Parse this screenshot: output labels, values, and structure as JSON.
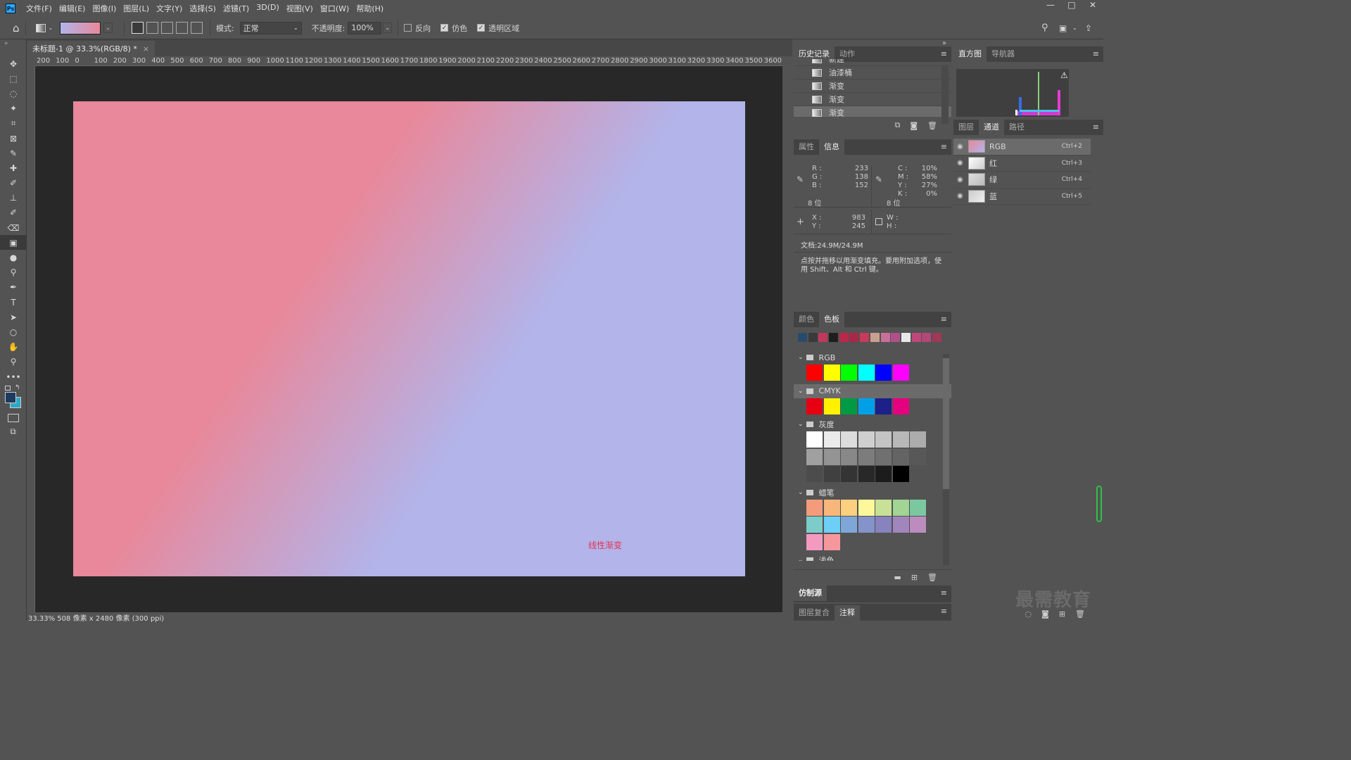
{
  "app": {
    "logo": "Ps"
  },
  "menu": [
    "文件(F)",
    "编辑(E)",
    "图像(I)",
    "图层(L)",
    "文字(Y)",
    "选择(S)",
    "滤镜(T)",
    "3D(D)",
    "视图(V)",
    "窗口(W)",
    "帮助(H)"
  ],
  "window_controls": {
    "minimize": "—",
    "maximize": "□",
    "close": "✕"
  },
  "options": {
    "mode_label": "模式:",
    "mode_value": "正常",
    "opacity_label": "不透明度:",
    "opacity_value": "100%",
    "reverse_label": "反向",
    "dither_label": "仿色",
    "transparency_label": "透明区域",
    "reverse_checked": false,
    "dither_checked": true,
    "transparency_checked": true,
    "gradient_colors": [
      "#b2b4ea",
      "#e8889a"
    ]
  },
  "tools": [
    "move-icon",
    "marquee-icon",
    "lasso-icon",
    "magic-wand-icon",
    "crop-icon",
    "frame-icon",
    "eyedropper-icon",
    "healing-icon",
    "brush-icon",
    "stamp-icon",
    "history-brush-icon",
    "eraser-icon",
    "gradient-icon",
    "blur-icon",
    "dodge-icon",
    "pen-icon",
    "type-icon",
    "path-select-icon",
    "ellipse-icon",
    "hand-icon",
    "zoom-icon",
    "more-icon"
  ],
  "tool_glyphs": [
    "✥",
    "⬚",
    "◌",
    "✦",
    "⌗",
    "⊠",
    "✎",
    "✚",
    "✐",
    "⊥",
    "✐",
    "⌫",
    "▣",
    "●",
    "⚲",
    "✒",
    "T",
    "➤",
    "○",
    "✋",
    "⚲",
    "•••"
  ],
  "document": {
    "tab_title": "未标题-1 @ 33.3%(RGB/8) *",
    "tab_close": "×",
    "canvas_label": "线性渐变",
    "gradient_start": "#e8889a",
    "gradient_end": "#b2b4ea"
  },
  "ruler_top": [
    "200",
    "100",
    "0",
    "100",
    "200",
    "300",
    "400",
    "500",
    "600",
    "700",
    "800",
    "900",
    "1000",
    "1100",
    "1200",
    "1300",
    "1400",
    "1500",
    "1600",
    "1700",
    "1800",
    "1900",
    "2000",
    "2100",
    "2200",
    "2300",
    "2400",
    "2500",
    "2600",
    "2700",
    "2800",
    "2900",
    "3000",
    "3100",
    "3200",
    "3300",
    "3400",
    "3500",
    "3600"
  ],
  "status": {
    "text": "33.33% 508 像素 x 2480 像素 (300 ppi)"
  },
  "history_panel": {
    "tabs": [
      "历史记录",
      "动作"
    ],
    "items": [
      {
        "label": "新建",
        "selected": false
      },
      {
        "label": "油漆桶",
        "selected": false
      },
      {
        "label": "渐变",
        "selected": false
      },
      {
        "label": "渐变",
        "selected": false
      },
      {
        "label": "渐变",
        "selected": true
      }
    ]
  },
  "info_panel": {
    "tabs": [
      "属性",
      "信息"
    ],
    "rgb": {
      "r_label": "R :",
      "g_label": "G :",
      "b_label": "B :",
      "r": "233",
      "g": "138",
      "b": "152"
    },
    "cmyk": {
      "c_label": "C :",
      "m_label": "M :",
      "y_label": "Y :",
      "k_label": "K :",
      "c": "10%",
      "m": "58%",
      "y": "27%",
      "k": "0%"
    },
    "bits_left": "8 位",
    "bits_right": "8 位",
    "coords": {
      "x_label": "X :",
      "y_label": "Y :",
      "x": "983",
      "y": "245"
    },
    "size": {
      "w_label": "W :",
      "h_label": "H :"
    },
    "doc_size": "文档:24.9M/24.9M",
    "hint": "点按并拖移以用渐变填充。要用附加选项，使用 Shift、Alt 和 Ctrl 键。"
  },
  "swatches_panel": {
    "tabs": [
      "颜色",
      "色板"
    ],
    "recent": [
      "#2a4a6b",
      "#3a3a3a",
      "#c0385a",
      "#1e1e1e",
      "#b8284a",
      "#a8284a",
      "#c83a5a",
      "#c8a090",
      "#c8709a",
      "#b0508a",
      "#e8e8e8",
      "#c04878",
      "#b04878",
      "#a03858"
    ],
    "groups": [
      {
        "name": "RGB",
        "rows": [
          [
            "#ff0000",
            "#ffff00",
            "#00ff00",
            "#00ffff",
            "#0000ff",
            "#ff00ff"
          ]
        ]
      },
      {
        "name": "CMYK",
        "rows": [
          [
            "#e60012",
            "#fff100",
            "#009944",
            "#00a0e9",
            "#1d2088",
            "#e4007f"
          ]
        ]
      },
      {
        "name": "灰度",
        "rows": [
          [
            "#ffffff",
            "#ebebeb",
            "#dcdcdc",
            "#cfcfcf",
            "#c4c4c4",
            "#b8b8b8",
            "#acacac"
          ],
          [
            "#a0a0a0",
            "#949494",
            "#888888",
            "#7c7c7c",
            "#707070",
            "#646464",
            "#585858"
          ],
          [
            "#4c4c4c",
            "#404040",
            "#343434",
            "#282828",
            "#1c1c1c",
            "#000000"
          ]
        ]
      },
      {
        "name": "蜡笔",
        "rows": [
          [
            "#f39b7a",
            "#f7b67a",
            "#fcd07f",
            "#fff89a",
            "#c8e196",
            "#a2d493",
            "#7bc8a0"
          ],
          [
            "#7ccdc9",
            "#6ecff6",
            "#7ea7d8",
            "#8493ca",
            "#8882be",
            "#a186be",
            "#bc8cbf"
          ],
          [
            "#f49ac1",
            "#f5989d"
          ]
        ]
      },
      {
        "name": "浅色",
        "rows": []
      }
    ]
  },
  "clone_source_tab": "仿制源",
  "bottom_tabs": [
    "图层复合",
    "注释"
  ],
  "histogram_panel": {
    "tabs": [
      "直方图",
      "导航器"
    ],
    "warning": "⚠"
  },
  "channels_panel": {
    "tabs": [
      "图层",
      "通道",
      "路径"
    ],
    "items": [
      {
        "label": "RGB",
        "shortcut": "Ctrl+2",
        "selected": true
      },
      {
        "label": "红",
        "shortcut": "Ctrl+3",
        "selected": false
      },
      {
        "label": "绿",
        "shortcut": "Ctrl+4",
        "selected": false
      },
      {
        "label": "蓝",
        "shortcut": "Ctrl+5",
        "selected": false
      }
    ]
  },
  "watermark": "最需教育"
}
